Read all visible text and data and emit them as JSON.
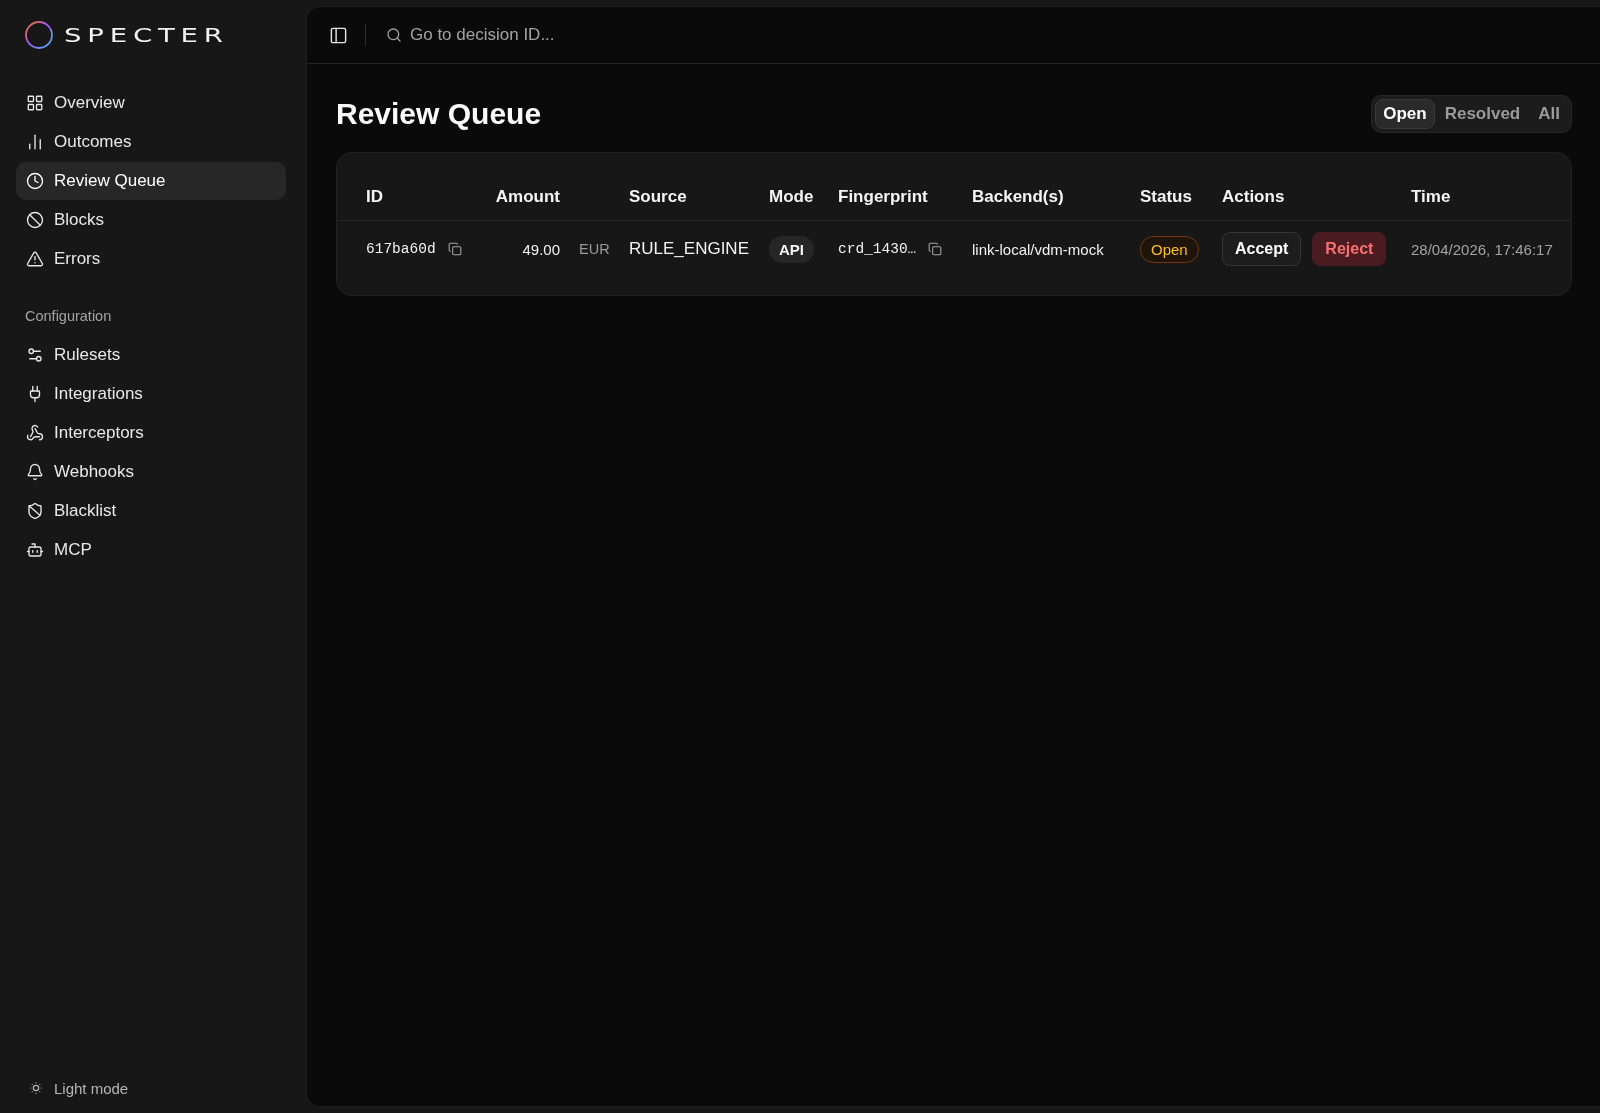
{
  "sidebar": {
    "logo": "SPECTER",
    "nav": [
      {
        "label": "Overview",
        "selected": false
      },
      {
        "label": "Outcomes",
        "selected": false
      },
      {
        "label": "Review Queue",
        "selected": true
      },
      {
        "label": "Blocks",
        "selected": false
      },
      {
        "label": "Errors",
        "selected": false
      }
    ],
    "sections": [
      {
        "title": "Configuration",
        "items": [
          {
            "label": "Rulesets",
            "selected": false
          },
          {
            "label": "Integrations",
            "selected": false
          },
          {
            "label": "Interceptors",
            "selected": false
          },
          {
            "label": "Webhooks",
            "selected": false
          },
          {
            "label": "Blacklist",
            "selected": false
          },
          {
            "label": "MCP",
            "selected": false
          }
        ]
      }
    ],
    "theme_toggle": {
      "label": "Light mode"
    }
  },
  "topbar": {
    "search": {
      "placeholder": "Go to decision ID..."
    }
  },
  "page": {
    "title": "Review Queue",
    "filters": [
      {
        "label": "Open",
        "selected": true
      },
      {
        "label": "Resolved",
        "selected": false
      },
      {
        "label": "All",
        "selected": false
      }
    ]
  },
  "table": {
    "columns": [
      "ID",
      "Amount",
      "Source",
      "Mode",
      "Fingerprint",
      "Backend(s)",
      "Status",
      "Actions",
      "Time"
    ],
    "rows": [
      {
        "id": "617ba60d",
        "amount": "49.00",
        "currency": "EUR",
        "source": "RULE_ENGINE",
        "mode": "API",
        "fingerprint": "crd_1430…",
        "backends": "link-local/vdm-mock",
        "status": {
          "label": "Open",
          "kind": "open"
        },
        "actions": [
          {
            "label": "Accept",
            "kind": "accept"
          },
          {
            "label": "Reject",
            "kind": "reject"
          }
        ],
        "time": "28/04/2026, 17:46:17"
      }
    ]
  }
}
